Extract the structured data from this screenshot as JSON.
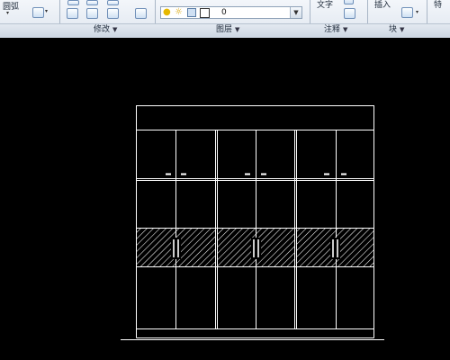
{
  "ribbon": {
    "arc_label": "圆弧",
    "modify_panel_label": "修改",
    "layers_panel_label": "图层",
    "annotation_panel_label": "注释",
    "block_panel_label": "块",
    "text_label": "文字",
    "insert_label": "插入",
    "current_layer": "0",
    "panel_dropdown_glyph": "▼",
    "colors": {
      "ribbon_bg": "#dfe6ef",
      "accent": "#3a6fb5"
    }
  },
  "drawing": {
    "background": "#000000",
    "line_color": "#ffffff",
    "hatch_color": "#ffffff",
    "content": "cabinet elevation: 3 door sections, 4 rows, glass hatched band with handles"
  }
}
